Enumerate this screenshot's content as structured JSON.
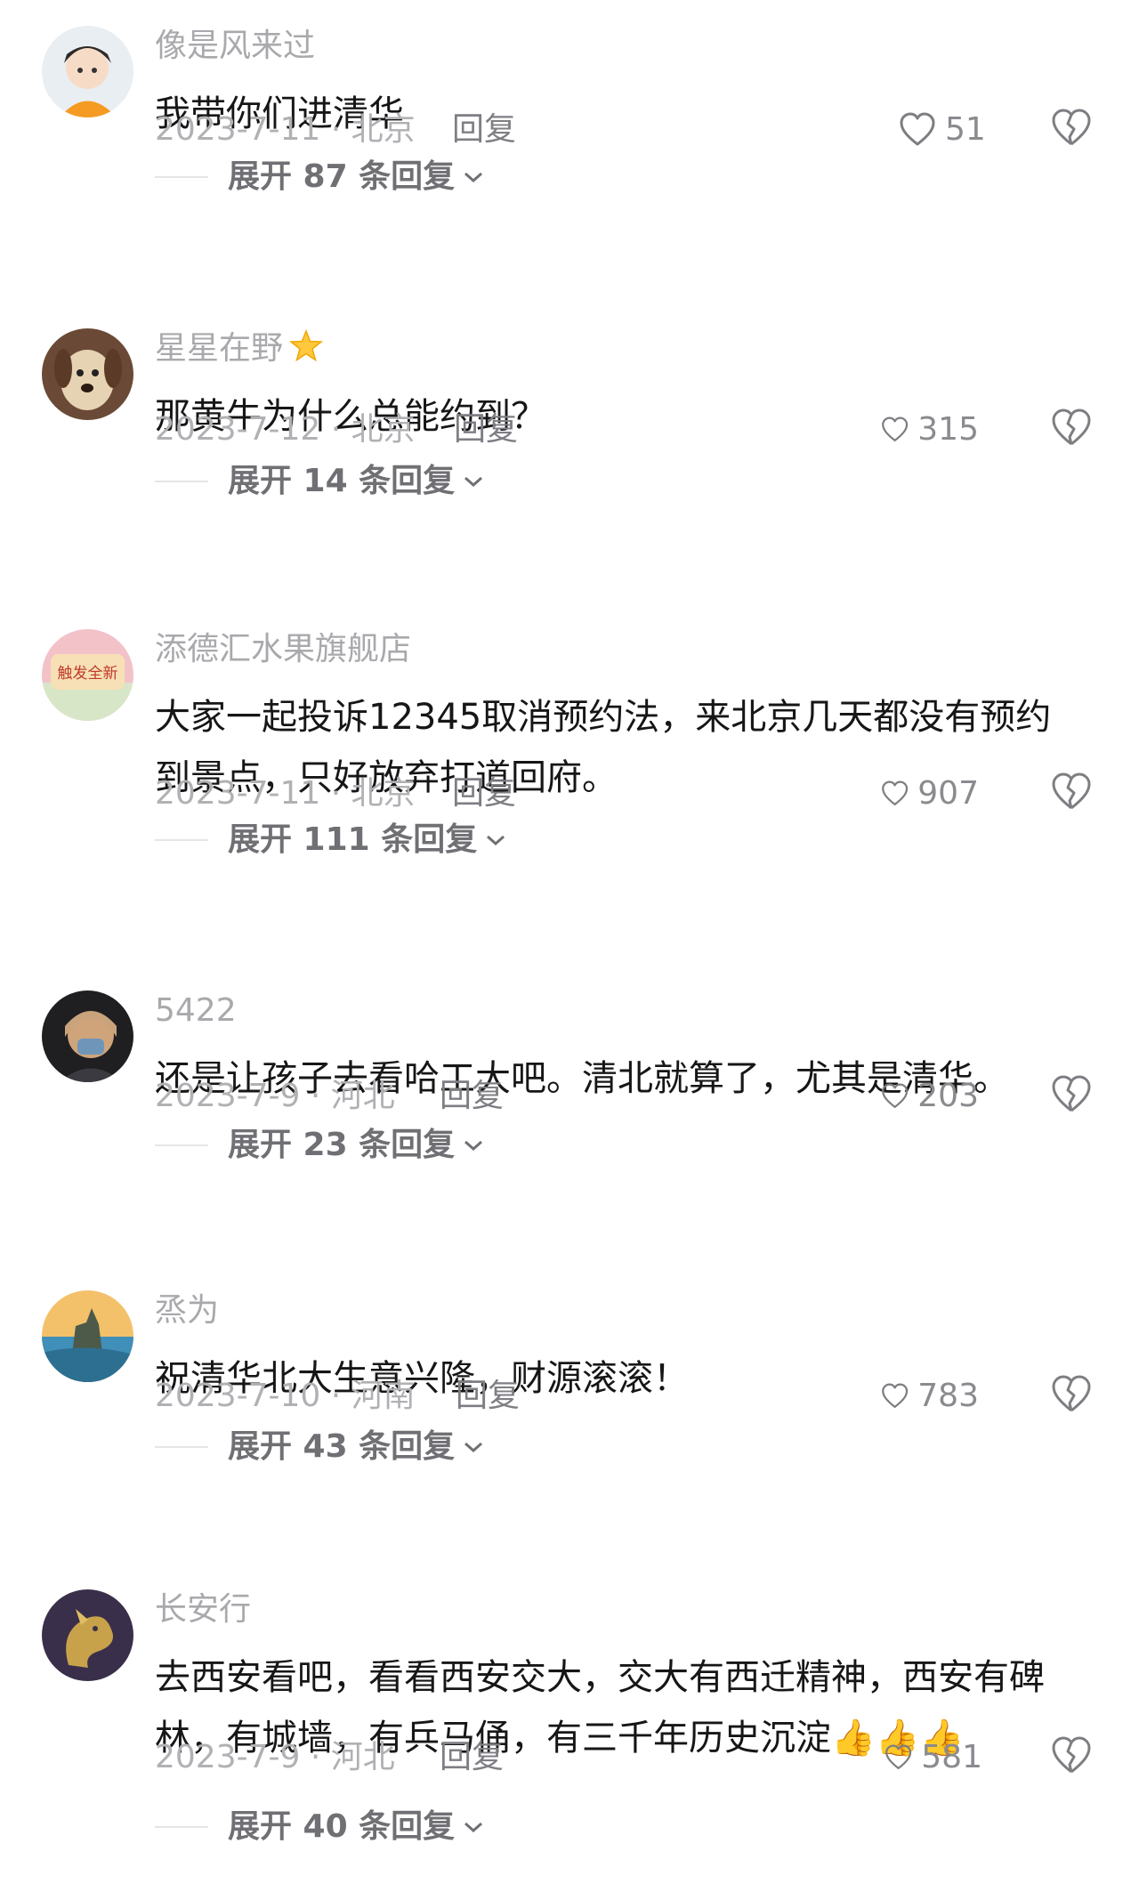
{
  "comments": [
    {
      "username": "像是风来过",
      "text": "我带你们进清华",
      "date_location": "2023-7-11 · 北京",
      "reply_label": "回复",
      "likes": "51",
      "expand_label": "展开 87 条回复"
    },
    {
      "username": "星星在野",
      "text": "那黄牛为什么总能约到？",
      "date_location": "2023-7-12 · 北京",
      "reply_label": "回复",
      "likes": "315",
      "expand_label": "展开 14 条回复"
    },
    {
      "username": "添德汇水果旗舰店",
      "text": "大家一起投诉12345取消预约法，来北京几天都没有预约到景点，只好放弃打道回府。",
      "date_location": "2023-7-11 · 北京",
      "reply_label": "回复",
      "likes": "907",
      "expand_label": "展开 111 条回复",
      "avatar_text": "触发全新"
    },
    {
      "username": "5422",
      "text": "还是让孩子去看哈工大吧。清北就算了，尤其是清华。",
      "date_location": "2023-7-9 · 河北",
      "reply_label": "回复",
      "likes": "203",
      "expand_label": "展开 23 条回复"
    },
    {
      "username": "烝为",
      "text": "祝清华北大生意兴隆，财源滚滚！",
      "date_location": "2023-7-10 · 河南",
      "reply_label": "回复",
      "likes": "783",
      "expand_label": "展开 43 条回复"
    },
    {
      "username": "长安行",
      "text": "去西安看吧，看看西安交大，交大有西迁精神，西安有碑林，有城墙，有兵马俑，有三千年历史沉淀👍👍👍",
      "date_location": "2023-7-9 · 河北",
      "reply_label": "回复",
      "likes": "581",
      "expand_label": "展开 40 条回复"
    }
  ]
}
